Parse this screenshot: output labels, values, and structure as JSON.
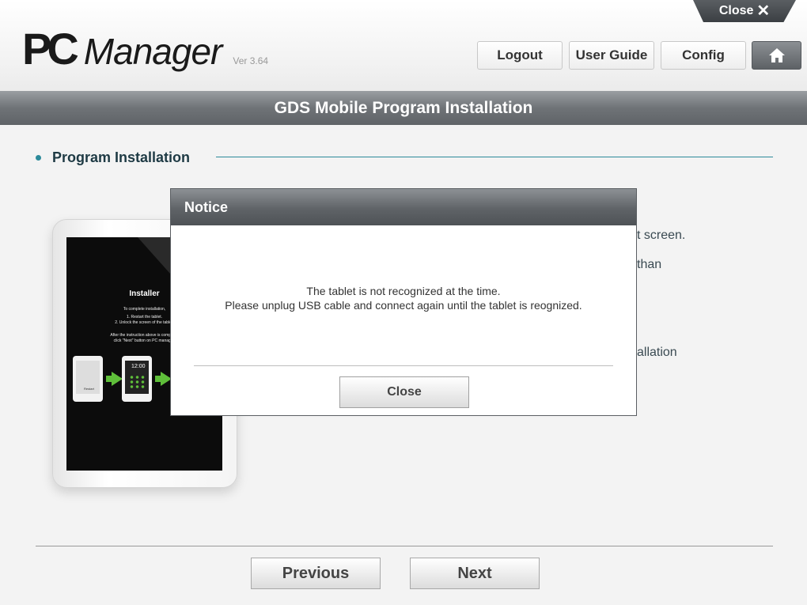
{
  "header": {
    "close_label": "Close",
    "logo_pc": "PC",
    "logo_manager": "Manager",
    "version": "Ver 3.64",
    "logout": "Logout",
    "user_guide": "User Guide",
    "config": "Config",
    "home_icon": "home-icon"
  },
  "page": {
    "title": "GDS Mobile Program Installation",
    "section_title": "Program Installation",
    "partial_lines": [
      "t screen.",
      "than",
      "allation"
    ]
  },
  "tablet_screen": {
    "title": "Installer",
    "line1": "To complete installation,",
    "line2": "1. Restart the tablet.",
    "line3": "2. Unlock the screen of the tablet.",
    "line4": "After the instruction above is complete,",
    "line5": "click \"Next\" button on PC manager.",
    "restart_label": "Restart",
    "time": "12:00"
  },
  "modal": {
    "title": "Notice",
    "message_line1": "The tablet is not recognized at the time.",
    "message_line2": "Please unplug USB cable and connect again until the tablet is reognized.",
    "close_button": "Close"
  },
  "footer": {
    "previous": "Previous",
    "next": "Next"
  },
  "colors": {
    "accent_teal": "#2c8a9a",
    "titlebar_gray": "#6f7377",
    "arrow_green": "#5fbf3a"
  }
}
